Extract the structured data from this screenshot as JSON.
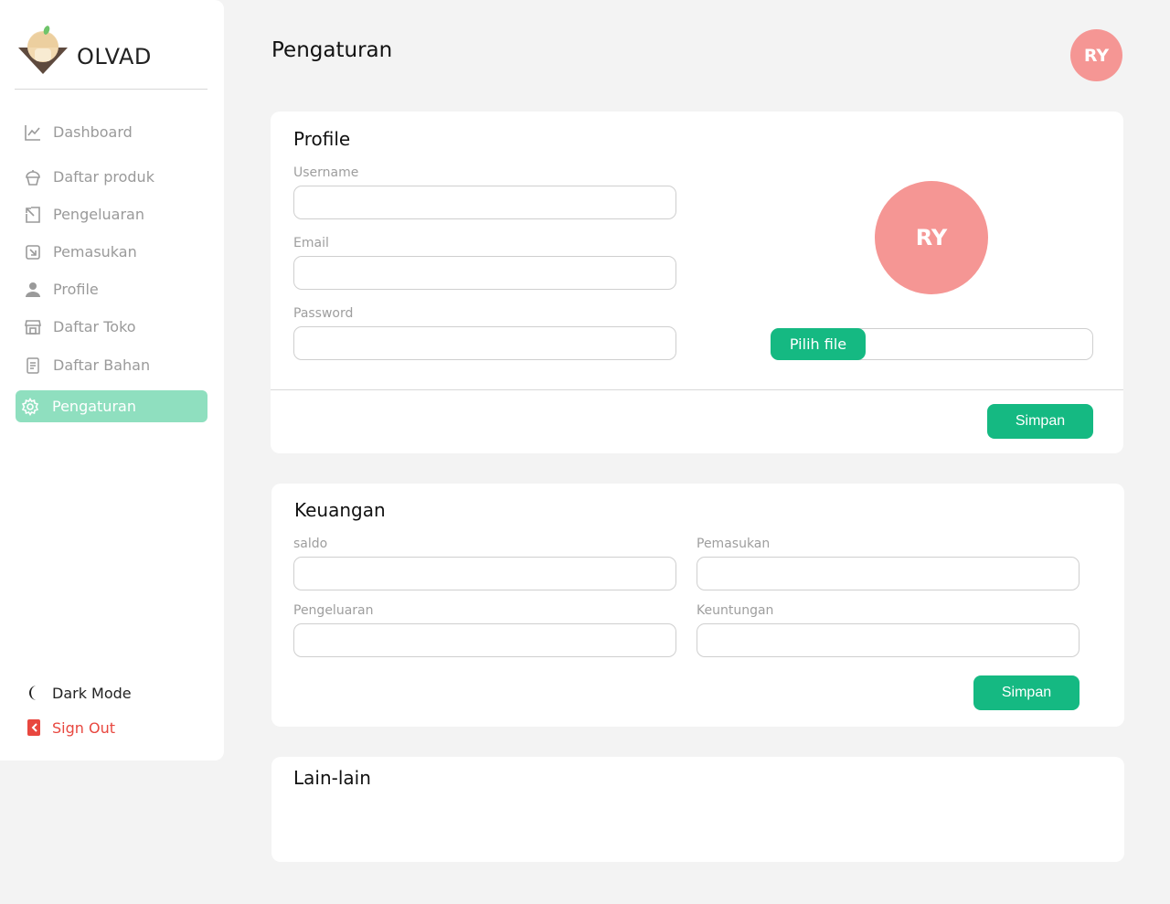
{
  "brand": {
    "name": "OLVAD"
  },
  "sidebar": {
    "items": [
      {
        "label": "Dashboard",
        "icon": "chart-line-icon"
      },
      {
        "label": "Daftar produk",
        "icon": "cupcake-icon"
      },
      {
        "label": "Pengeluaran",
        "icon": "arrow-out-icon"
      },
      {
        "label": "Pemasukan",
        "icon": "arrow-in-icon"
      },
      {
        "label": "Profile",
        "icon": "user-icon"
      },
      {
        "label": "Daftar Toko",
        "icon": "store-icon"
      },
      {
        "label": "Daftar Bahan",
        "icon": "document-icon"
      },
      {
        "label": "Pengaturan",
        "icon": "gear-icon",
        "active": true
      }
    ],
    "dark_mode": "Dark Mode",
    "sign_out": "Sign Out"
  },
  "header": {
    "title": "Pengaturan",
    "avatar_initials": "RY"
  },
  "profile": {
    "title": "Profile",
    "username_label": "Username",
    "username_value": "",
    "email_label": "Email",
    "email_value": "",
    "password_label": "Password",
    "password_value": "",
    "avatar_initials": "RY",
    "file_button": "Pilih file",
    "save_label": "Simpan"
  },
  "keuangan": {
    "title": "Keuangan",
    "saldo_label": "saldo",
    "saldo_value": "",
    "pemasukan_label": "Pemasukan",
    "pemasukan_value": "",
    "pengeluaran_label": "Pengeluaran",
    "pengeluaran_value": "",
    "keuntungan_label": "Keuntungan",
    "keuntungan_value": "",
    "save_label": "Simpan"
  },
  "lain": {
    "title": "Lain-lain"
  },
  "colors": {
    "accent": "#15b982",
    "active_nav": "#8fdfbf",
    "avatar": "#f59694",
    "danger": "#e8473f"
  }
}
